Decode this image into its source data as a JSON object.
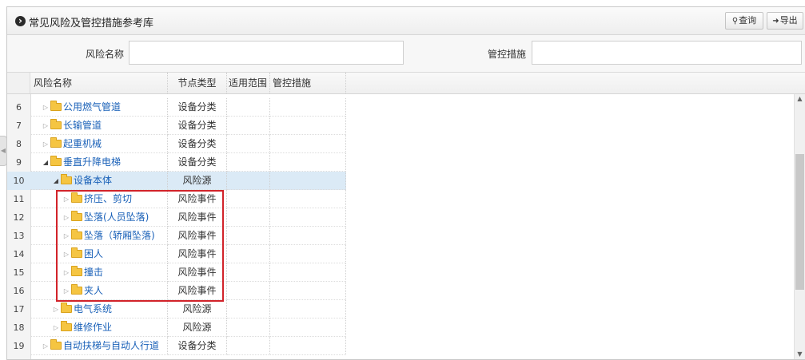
{
  "panel": {
    "title": "常见风险及管控措施参考库",
    "title_icon": "circle-arrow-right-icon",
    "query_button": "查询",
    "query_icon": "search-icon",
    "export_button": "导出",
    "export_icon": "export-icon"
  },
  "filters": {
    "risk_name_label": "风险名称",
    "risk_name_value": "",
    "control_label": "管控措施",
    "control_value": ""
  },
  "grid": {
    "columns": [
      "风险名称",
      "节点类型",
      "适用范围",
      "管控措施"
    ],
    "rows": [
      {
        "num": "6",
        "name": "公用燃气管道",
        "type": "设备分类",
        "level": 0,
        "expanded": false
      },
      {
        "num": "7",
        "name": "长输管道",
        "type": "设备分类",
        "level": 0,
        "expanded": false
      },
      {
        "num": "8",
        "name": "起重机械",
        "type": "设备分类",
        "level": 0,
        "expanded": false
      },
      {
        "num": "9",
        "name": "垂直升降电梯",
        "type": "设备分类",
        "level": 0,
        "expanded": true
      },
      {
        "num": "10",
        "name": "设备本体",
        "type": "风险源",
        "level": 1,
        "expanded": true,
        "selected": true
      },
      {
        "num": "11",
        "name": "挤压、剪切",
        "type": "风险事件",
        "level": 2,
        "expanded": false
      },
      {
        "num": "12",
        "name": "坠落(人员坠落)",
        "type": "风险事件",
        "level": 2,
        "expanded": false
      },
      {
        "num": "13",
        "name": "坠落（轿厢坠落)",
        "type": "风险事件",
        "level": 2,
        "expanded": false
      },
      {
        "num": "14",
        "name": "困人",
        "type": "风险事件",
        "level": 2,
        "expanded": false
      },
      {
        "num": "15",
        "name": "撞击",
        "type": "风险事件",
        "level": 2,
        "expanded": false
      },
      {
        "num": "16",
        "name": "夹人",
        "type": "风险事件",
        "level": 2,
        "expanded": false
      },
      {
        "num": "17",
        "name": "电气系统",
        "type": "风险源",
        "level": 1,
        "expanded": false
      },
      {
        "num": "18",
        "name": "维修作业",
        "type": "风险源",
        "level": 1,
        "expanded": false
      },
      {
        "num": "19",
        "name": "自动扶梯与自动人行道",
        "type": "设备分类",
        "level": 0,
        "expanded": false
      }
    ]
  },
  "colors": {
    "link": "#1a61b8",
    "selected_row": "#dbeaf6",
    "highlight_border": "#d2232a",
    "folder": "#f5c542"
  }
}
